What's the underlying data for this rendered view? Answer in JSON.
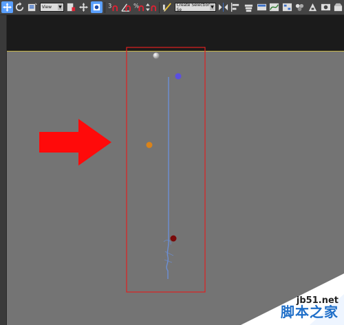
{
  "toolbar": {
    "view_select": "View",
    "selection_set_select": "Create Selection Se",
    "snap_angle_label": "3",
    "active_color": "#5aa0ff"
  },
  "viewport": {
    "background_color": "#747474",
    "header_color": "#1b1b1b",
    "selection_box_color": "#e02020",
    "spline_color": "#6b8fd6",
    "points": [
      {
        "name": "gray-point",
        "color": "#c8c8c8"
      },
      {
        "name": "blue-point",
        "color": "#5b4fe0"
      },
      {
        "name": "orange-point",
        "color": "#d9831a"
      },
      {
        "name": "darkred-point",
        "color": "#7a0a0a"
      }
    ],
    "arrow_color": "#ff0a0a"
  },
  "watermark": {
    "domain": "jb51.net",
    "site_name": "脚本之家"
  }
}
